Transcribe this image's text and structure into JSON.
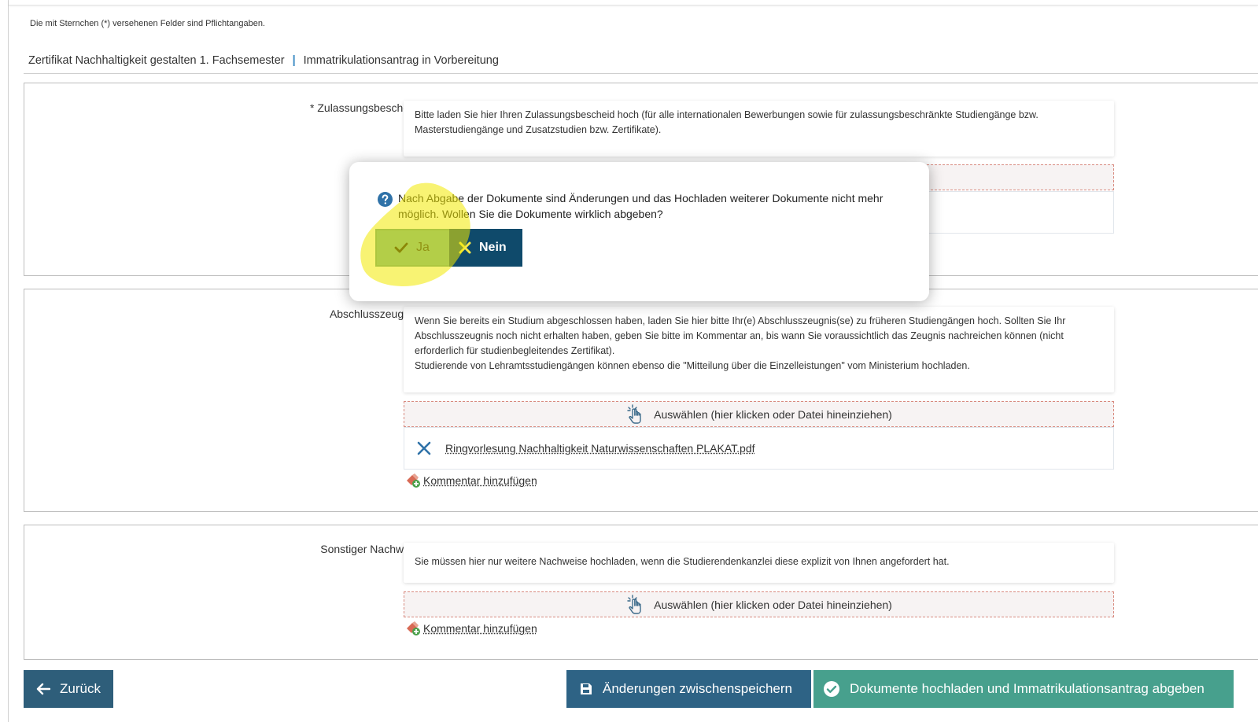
{
  "required_note": "Die mit Sternchen (*) versehenen Felder sind Pflichtangaben.",
  "breadcrumb": {
    "program": "Zertifikat Nachhaltigkeit gestalten 1. Fachsemester",
    "separator": "|",
    "status": "Immatrikulationsantrag in Vorbereitung"
  },
  "sections": {
    "zulassung": {
      "label": "* Zulassungsbescheid",
      "info": "Bitte laden Sie hier Ihren Zulassungsbescheid hoch (für alle internationalen Bewerbungen sowie für zulassungsbeschränkte Studiengänge bzw. Masterstudiengänge und Zusatzstudien bzw. Zertifikate)."
    },
    "abschluss": {
      "label": "Abschlusszeugnis",
      "info_line1": "Wenn Sie bereits ein Studium abgeschlossen haben, laden Sie hier bitte Ihr(e) Abschlusszeugnis(se) zu früheren Studiengängen hoch. Sollten Sie Ihr Abschlusszeugnis noch nicht erhalten haben, geben Sie bitte im Kommentar an, bis wann Sie voraussichtlich das Zeugnis nachreichen können (nicht erforderlich für studienbegleitendes Zertifikat).",
      "info_line2": "Studierende von Lehramtsstudiengängen können ebenso die \"Mitteilung über die Einzelleistungen\" vom Ministerium hochladen.",
      "dropzone": "Auswählen (hier klicken oder Datei hineinziehen)",
      "file": "Ringvorlesung Nachhaltigkeit Naturwissenschaften PLAKAT.pdf",
      "comment": "Kommentar hinzufügen"
    },
    "sonstiger": {
      "label": "Sonstiger Nachweis",
      "info": "Sie müssen hier nur weitere Nachweise hochladen, wenn die Studierendenkanzlei diese explizit von Ihnen angefordert hat.",
      "dropzone": "Auswählen (hier klicken oder Datei hineinziehen)",
      "comment": "Kommentar hinzufügen"
    }
  },
  "buttons": {
    "back": "Zurück",
    "save": "Änderungen zwischenspeichern",
    "submit": "Dokumente hochladen und Immatrikulationsantrag abgeben"
  },
  "dialog": {
    "message": "Nach Abgabe der Dokumente sind Änderungen und das Hochladen weiterer Dokumente nicht mehr möglich. Wollen Sie die Dokumente wirklich abgeben?",
    "yes": "Ja",
    "no": "Nein",
    "icon": "question-icon"
  },
  "colors": {
    "primary": "#2e6385",
    "success": "#47a08d",
    "dialog_yes": "#67ae9f",
    "dialog_no": "#0f4a6b",
    "highlight": "#f2ea00",
    "link_separator": "#3b8ac4"
  }
}
